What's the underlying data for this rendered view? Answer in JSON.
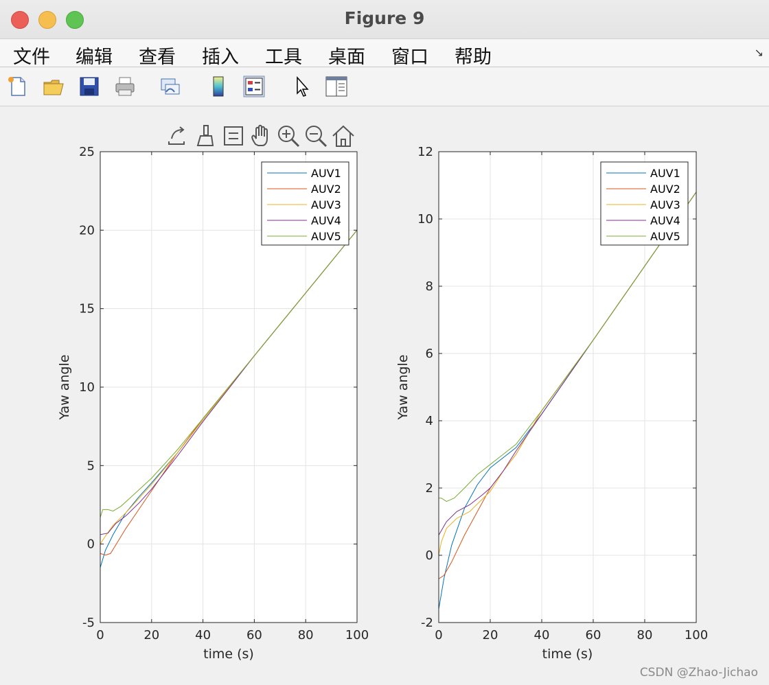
{
  "window": {
    "title": "Figure 9"
  },
  "menu": [
    "文件",
    "编辑",
    "查看",
    "插入",
    "工具",
    "桌面",
    "窗口",
    "帮助"
  ],
  "toolbar_icons": [
    "new-file-icon",
    "open-folder-icon",
    "save-icon",
    "print-icon",
    "link-plot-icon",
    "colorbar-icon",
    "legend-icon",
    "pointer-icon",
    "property-inspector-icon"
  ],
  "axes_toolbar_icons": [
    "export-icon",
    "brush-icon",
    "data-tips-icon",
    "pan-icon",
    "zoom-in-icon",
    "zoom-out-icon",
    "home-icon"
  ],
  "watermark": "CSDN @Zhao-Jichao",
  "colors": {
    "AUV1": "#0072BD",
    "AUV2": "#D95319",
    "AUV3": "#EDB120",
    "AUV4": "#7E2F8E",
    "AUV5": "#77AC30"
  },
  "chart_data": [
    {
      "type": "line",
      "xlabel": "time (s)",
      "ylabel": "Yaw angle",
      "xlim": [
        0,
        100
      ],
      "ylim": [
        -5,
        25
      ],
      "xticks": [
        0,
        20,
        40,
        60,
        80,
        100
      ],
      "yticks": [
        -5,
        0,
        5,
        10,
        15,
        20,
        25
      ],
      "grid": true,
      "legend": "top-right",
      "series": [
        {
          "name": "AUV1",
          "x": [
            0,
            2,
            5,
            10,
            15,
            20,
            30,
            40,
            60,
            80,
            100
          ],
          "y": [
            -1.5,
            -0.4,
            0.6,
            2.0,
            3.0,
            3.9,
            5.8,
            7.9,
            12.0,
            16.0,
            20.0
          ]
        },
        {
          "name": "AUV2",
          "x": [
            0,
            2,
            4,
            7,
            10,
            15,
            20,
            30,
            40,
            60,
            80,
            100
          ],
          "y": [
            -0.6,
            -0.7,
            -0.6,
            0.2,
            1.0,
            2.2,
            3.4,
            5.8,
            8.0,
            12.0,
            16.0,
            20.0
          ]
        },
        {
          "name": "AUV3",
          "x": [
            0,
            2,
            5,
            10,
            15,
            20,
            30,
            40,
            60,
            80,
            100
          ],
          "y": [
            0.0,
            0.5,
            1.2,
            2.0,
            2.9,
            3.8,
            5.8,
            7.9,
            12.0,
            16.0,
            20.0
          ]
        },
        {
          "name": "AUV4",
          "x": [
            0,
            3,
            6,
            10,
            15,
            20,
            30,
            40,
            60,
            80,
            100
          ],
          "y": [
            0.6,
            0.7,
            1.3,
            1.8,
            2.6,
            3.5,
            5.6,
            7.8,
            12.0,
            16.0,
            20.0
          ]
        },
        {
          "name": "AUV5",
          "x": [
            0,
            1,
            2,
            3,
            5,
            8,
            12,
            20,
            30,
            40,
            60,
            80,
            100
          ],
          "y": [
            1.7,
            2.2,
            2.2,
            2.2,
            2.1,
            2.4,
            3.0,
            4.2,
            6.0,
            8.0,
            12.0,
            16.0,
            20.0
          ]
        }
      ]
    },
    {
      "type": "line",
      "xlabel": "time (s)",
      "ylabel": "Yaw angle",
      "xlim": [
        0,
        100
      ],
      "ylim": [
        -2,
        12
      ],
      "xticks": [
        0,
        20,
        40,
        60,
        80,
        100
      ],
      "yticks": [
        -2,
        0,
        2,
        4,
        6,
        8,
        10,
        12
      ],
      "grid": true,
      "legend": "top-right",
      "series": [
        {
          "name": "AUV1",
          "x": [
            0,
            2,
            5,
            10,
            15,
            20,
            25,
            30,
            40,
            60,
            80,
            100
          ],
          "y": [
            -1.6,
            -0.7,
            0.3,
            1.4,
            2.1,
            2.6,
            2.9,
            3.2,
            4.2,
            6.4,
            8.6,
            10.8
          ]
        },
        {
          "name": "AUV2",
          "x": [
            0,
            2,
            5,
            10,
            15,
            20,
            25,
            30,
            40,
            60,
            80,
            100
          ],
          "y": [
            -0.7,
            -0.6,
            -0.2,
            0.6,
            1.3,
            2.0,
            2.5,
            3.0,
            4.3,
            6.4,
            8.6,
            10.8
          ]
        },
        {
          "name": "AUV3",
          "x": [
            0,
            1,
            3,
            7,
            12,
            20,
            25,
            30,
            40,
            60,
            80,
            100
          ],
          "y": [
            0.0,
            0.4,
            0.8,
            1.1,
            1.3,
            1.9,
            2.5,
            3.0,
            4.3,
            6.4,
            8.6,
            10.8
          ]
        },
        {
          "name": "AUV4",
          "x": [
            0,
            3,
            7,
            12,
            17,
            20,
            25,
            30,
            40,
            60,
            80,
            100
          ],
          "y": [
            0.6,
            1.0,
            1.3,
            1.5,
            1.8,
            2.0,
            2.5,
            3.1,
            4.2,
            6.4,
            8.6,
            10.8
          ]
        },
        {
          "name": "AUV5",
          "x": [
            0,
            1,
            3,
            6,
            10,
            15,
            20,
            25,
            30,
            40,
            60,
            80,
            100
          ],
          "y": [
            1.7,
            1.7,
            1.6,
            1.7,
            2.0,
            2.4,
            2.7,
            3.0,
            3.3,
            4.3,
            6.4,
            8.6,
            10.8
          ]
        }
      ]
    }
  ]
}
